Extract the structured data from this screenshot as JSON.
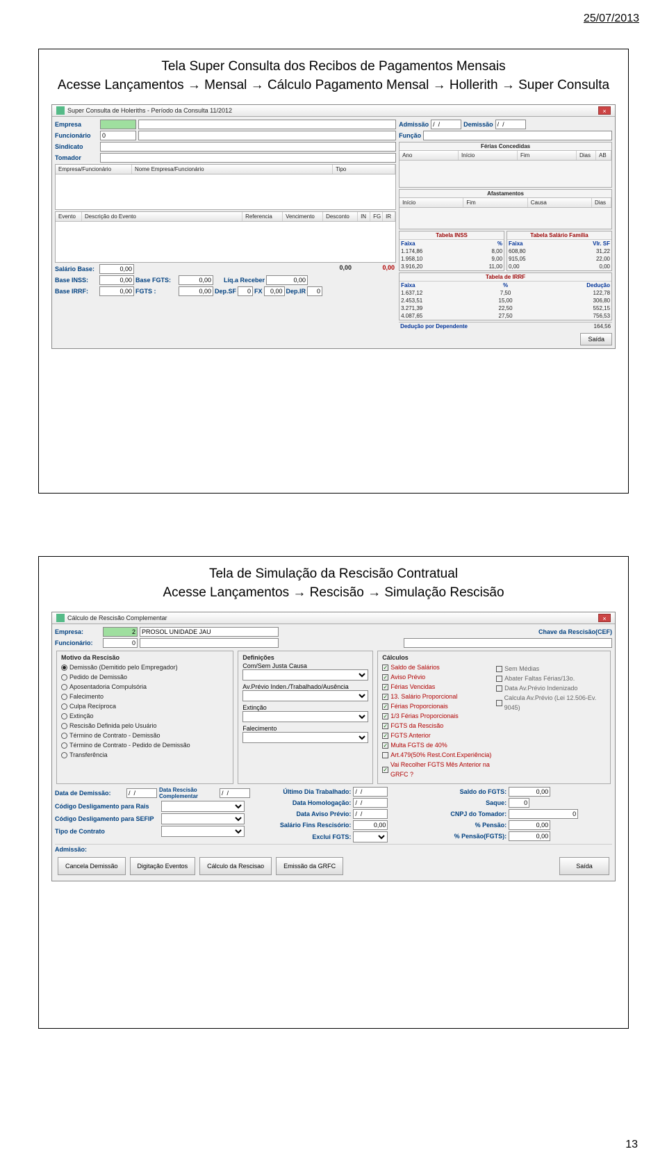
{
  "page": {
    "date": "25/07/2013",
    "page_number": "13"
  },
  "slide1": {
    "title_l1": "Tela  Super Consulta dos Recibos de Pagamentos Mensais",
    "title_l2": "Acesse Lançamentos → Mensal → Cálculo Pagamento Mensal → Hollerith → Super Consulta",
    "window_title": "Super Consulta de Holeriths  -  Período da Consulta 11/2012",
    "labels": {
      "empresa": "Empresa",
      "funcionario": "Funcionário",
      "sindicato": "Sindicato",
      "tomador": "Tomador",
      "admissao": "Admissão",
      "demissao": "Demissão",
      "funcao": "Função",
      "ferias_head": "Férias Concedidas",
      "ano": "Ano",
      "inicio": "Início",
      "fim": "Fim",
      "dias": "Dias",
      "ab": "AB",
      "afast_head": "Afastamentos",
      "causa": "Causa",
      "grid1_c1": "Empresa/Funcionário",
      "grid1_c2": "Nome Empresa/Funcionário",
      "grid1_c3": "Tipo",
      "grid2_c1": "Evento",
      "grid2_c2": "Descrição do Evento",
      "grid2_c3": "Referencia",
      "grid2_c4": "Vencimento",
      "grid2_c5": "Desconto",
      "grid2_c6": "IN",
      "grid2_c7": "FG",
      "grid2_c8": "IR",
      "salario_base": "Salário Base:",
      "base_inss": "Base INSS:",
      "base_irrf": "Base IRRF:",
      "base_fgts": "Base FGTS:",
      "fgts": "FGTS :",
      "liq": "Líq.a Receber",
      "depsf": "Dep.SF",
      "fx": "FX",
      "depir": "Dep.IR",
      "tab_inss": "Tabela INSS",
      "faixa": "Faixa",
      "pct": "%",
      "tab_sf": "Tabela Salário Família",
      "vlrsf": "Vlr. SF",
      "tab_irrf": "Tabela de IRRF",
      "deducao": "Dedução",
      "ded_dep": "Dedução por Dependente",
      "saida": "Saída"
    },
    "values": {
      "funcionario": "0",
      "admissao": "/  /",
      "demissao": "/  /",
      "zero": "0,00",
      "red_zero": "0,00",
      "sf0": "0",
      "fx0": "0,00",
      "ir0": "0",
      "inss_rows": [
        [
          "1.174,86",
          "8,00"
        ],
        [
          "1.958,10",
          "9,00"
        ],
        [
          "3.916,20",
          "11,00"
        ]
      ],
      "sf_rows": [
        [
          "608,80",
          "31,22"
        ],
        [
          "915,05",
          "22,00"
        ],
        [
          "0,00",
          "0,00"
        ]
      ],
      "irrf_rows": [
        [
          "1.637,12",
          "7,50",
          "122,78"
        ],
        [
          "2.453,51",
          "15,00",
          "306,80"
        ],
        [
          "3.271,39",
          "22,50",
          "552,15"
        ],
        [
          "4.087,65",
          "27,50",
          "756,53"
        ]
      ],
      "ded_dep_val": "164,56"
    }
  },
  "slide2": {
    "title_l1": "Tela  de Simulação da Rescisão Contratual",
    "title_l2": "Acesse Lançamentos → Rescisão  → Simulação Rescisão",
    "window_title": "Cálculo de Rescisão Complementar",
    "labels": {
      "empresa": "Empresa:",
      "funcionario": "Funcionário:",
      "chave": "Chave da Rescisão(CEF)",
      "motivo": "Motivo da Rescisão",
      "definicoes": "Definições",
      "calculos": "Cálculos",
      "comsem": "Com/Sem Justa Causa",
      "avprev": "Av.Prévio Inden./Trabalhado/Ausência",
      "extincao": "Extinção",
      "falecimento": "Falecimento",
      "data_dem": "Data de Demissão:",
      "data_resc": "Data Rescisão Complementar",
      "cod_rais": "Código Desligamento para Rais",
      "cod_sefip": "Código Desligamento para SEFIP",
      "tipo_contrato": "Tipo de Contrato",
      "ult_dia": "Último Dia Trabalhado:",
      "data_homol": "Data Homologação:",
      "data_aviso": "Data Aviso Prévio:",
      "sal_fins": "Salário Fins Rescisório:",
      "exclui_fgts": "Exclui FGTS:",
      "saldo_fgts": "Saldo do FGTS:",
      "saque": "Saque:",
      "cnpj": "CNPJ do Tomador:",
      "pct_pensao": "% Pensão:",
      "pct_pensao_fgts": "% Pensão(FGTS):",
      "admissao": "Admissão:",
      "btn_cancela": "Cancela Demissão",
      "btn_dig": "Digitação Eventos",
      "btn_calc": "Cálculo da Rescisao",
      "btn_grfc": "Emissão da GRFC",
      "btn_saida": "Saída"
    },
    "motivos": [
      "Demissão (Demitido pelo Empregador)",
      "Pedido de Demissão",
      "Aposentadoria Compulsória",
      "Falecimento",
      "Culpa Recíproca",
      "Extinção",
      "Rescisão Definida pelo Usuário",
      "Término de Contrato - Demissão",
      "Término de Contrato - Pedido de Demissão",
      "Transferência"
    ],
    "calculos_left": [
      "Saldo de Salários",
      "Aviso Prévio",
      "Férias Vencidas",
      "13. Salário Proporcional",
      "Férias Proporcionais",
      "1/3 Férias Proporcionais",
      "FGTS da Rescisão",
      "FGTS Anterior",
      "Multa FGTS de 40%",
      "Art.479(50% Rest.Cont.Experiência)",
      "Vai Recolher FGTS Mês Anterior na GRFC ?"
    ],
    "calculos_right": [
      "Sem Médias",
      "Abater Faltas Férias/13o.",
      "Data Av.Prévio Indenizado",
      "Calcula Av.Prévio (Lei 12.506-Ev. 9045)"
    ],
    "values": {
      "empresa_cod": "2",
      "empresa_nome": "PROSOL UNIDADE JAU",
      "funcionario": "0",
      "slash": "/  /",
      "zero": "0,00",
      "zero_int": "0",
      "saque": "0",
      "cnpj": "0"
    }
  }
}
